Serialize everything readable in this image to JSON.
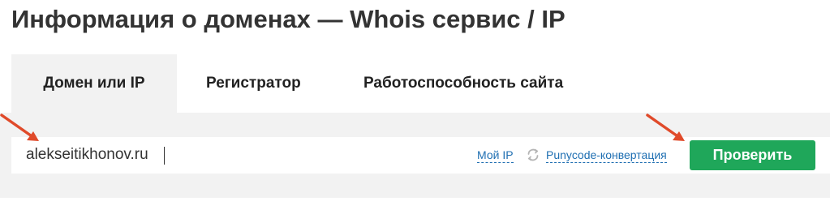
{
  "page": {
    "title": "Информация о доменах — Whois сервис / IP"
  },
  "tabs": [
    {
      "label": "Домен или IP",
      "active": true
    },
    {
      "label": "Регистратор",
      "active": false
    },
    {
      "label": "Работоспособность сайта",
      "active": false
    }
  ],
  "search": {
    "value": "alekseitikhonov.ru",
    "my_ip_link": "Мой IP",
    "punycode_icon": "refresh-icon",
    "punycode_link": "Punycode-конвертация",
    "submit_label": "Проверить"
  },
  "annotations": {
    "arrow_icon": "red-arrow-icon"
  },
  "colors": {
    "panel_background": "#f2f2f2",
    "active_tab_background": "#f2f2f2",
    "button_green": "#1fa75a",
    "link_blue": "#1f6fb2",
    "annotation_arrow": "#e04a2a"
  }
}
